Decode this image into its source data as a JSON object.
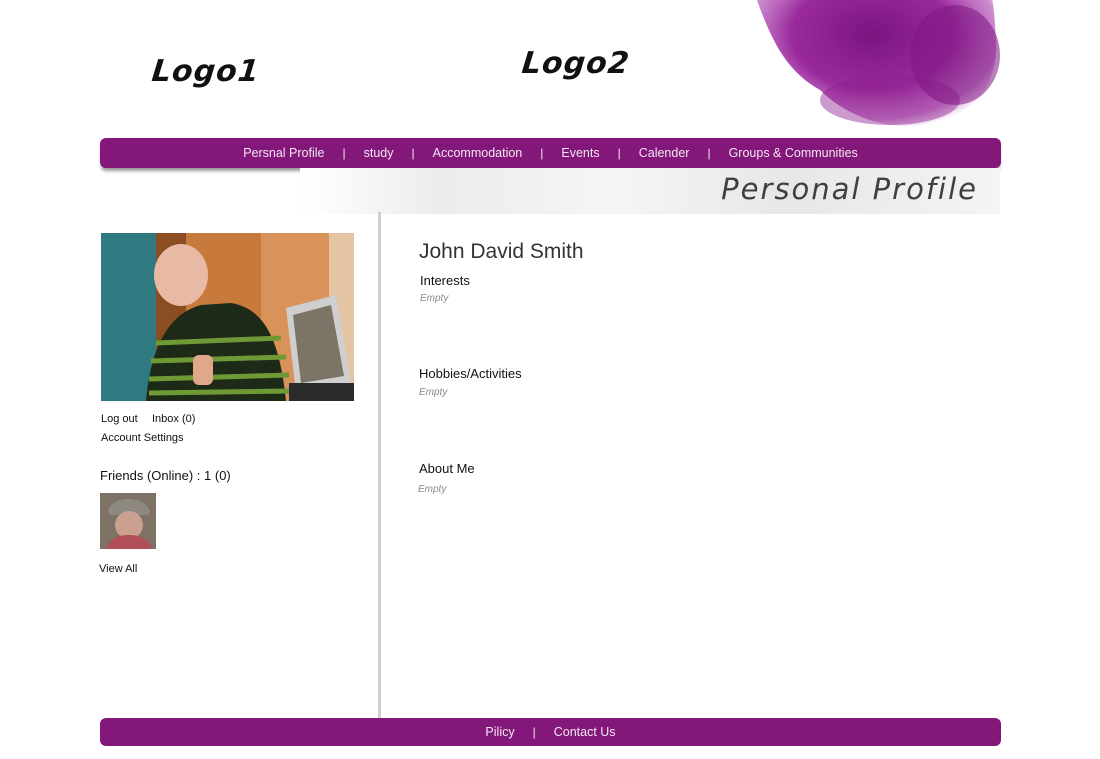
{
  "header": {
    "logo1": "Logo1",
    "logo2": "Logo2"
  },
  "nav": {
    "items": [
      "Persnal Profile",
      "study",
      "Accommodation",
      "Events",
      "Calender",
      "Groups & Communities"
    ],
    "separator": "|"
  },
  "banner": {
    "title": "Personal Profile"
  },
  "sidebar": {
    "logout": "Log out",
    "inbox": "Inbox (0)",
    "account_settings": "Account Settings",
    "friends_title": "Friends (Online) : 1 (0)",
    "view_all": "View All"
  },
  "profile": {
    "name": "John David Smith",
    "interests": {
      "label": "Interests",
      "value": "Empty"
    },
    "hobbies": {
      "label": "Hobbies/Activities",
      "value": "Empty"
    },
    "about": {
      "label": "About Me",
      "value": "Empty"
    }
  },
  "footer": {
    "items": [
      "Pilicy",
      "Contact Us"
    ],
    "separator": "|"
  },
  "colors": {
    "accent": "#83177a",
    "nav_text": "#f3e7f2",
    "splash": "#8f1f8f"
  }
}
